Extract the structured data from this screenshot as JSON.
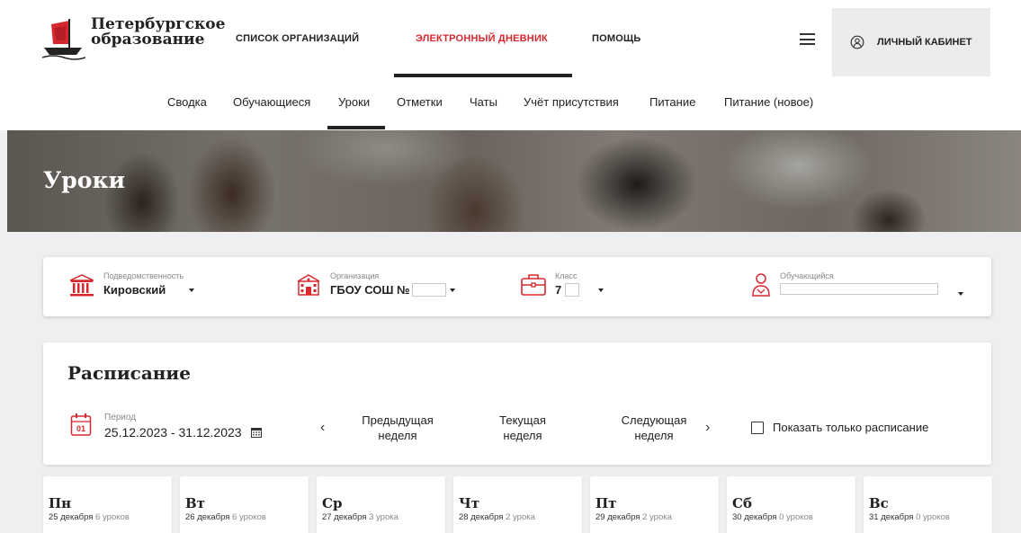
{
  "brand": {
    "line1": "Петербургское",
    "line2": "образование"
  },
  "topnav": {
    "items": [
      "список организаций",
      "электронный дневник",
      "помощь"
    ],
    "active_index": 1
  },
  "cabinet": {
    "label": "личный кабинет",
    "icon": "user-circle-icon"
  },
  "subnav": {
    "items": [
      "Сводка",
      "Обучающиеся",
      "Уроки",
      "Отметки",
      "Чаты",
      "Учёт присутствия",
      "Питание",
      "Питание (новое)"
    ],
    "active_index": 2
  },
  "hero": {
    "title": "Уроки"
  },
  "filters": {
    "subordination": {
      "caption": "Подведомственность",
      "value": "Кировский",
      "icon": "institution-icon"
    },
    "organization": {
      "caption": "Организация",
      "value": "ГБОУ СОШ №",
      "icon": "school-building-icon"
    },
    "class": {
      "caption": "Класс",
      "value": "7",
      "icon": "briefcase-icon"
    },
    "student": {
      "caption": "Обучающийся",
      "value": "",
      "icon": "person-icon"
    }
  },
  "schedule": {
    "title": "Расписание",
    "period_caption": "Период",
    "period_value": "25.12.2023 - 31.12.2023",
    "period_icon_day": "01",
    "prev": {
      "line1": "Предыдущая",
      "line2": "неделя"
    },
    "current": {
      "line1": "Текущая",
      "line2": "неделя"
    },
    "next": {
      "line1": "Следующая",
      "line2": "неделя"
    },
    "only_schedule_label": "Показать только расписание",
    "only_schedule_checked": false
  },
  "days": [
    {
      "name": "Пн",
      "date": "25 декабря",
      "lessons": "6 уроков"
    },
    {
      "name": "Вт",
      "date": "26 декабря",
      "lessons": "6 уроков"
    },
    {
      "name": "Ср",
      "date": "27 декабря",
      "lessons": "3 урока"
    },
    {
      "name": "Чт",
      "date": "28 декабря",
      "lessons": "2 урока"
    },
    {
      "name": "Пт",
      "date": "29 декабря",
      "lessons": "2 урока"
    },
    {
      "name": "Сб",
      "date": "30 декабря",
      "lessons": "0 уроков"
    },
    {
      "name": "Вс",
      "date": "31 декабря",
      "lessons": "0 уроков"
    }
  ],
  "colors": {
    "accent": "#d7282f",
    "text": "#222222",
    "muted": "#888888",
    "page_bg": "#efeff1"
  }
}
